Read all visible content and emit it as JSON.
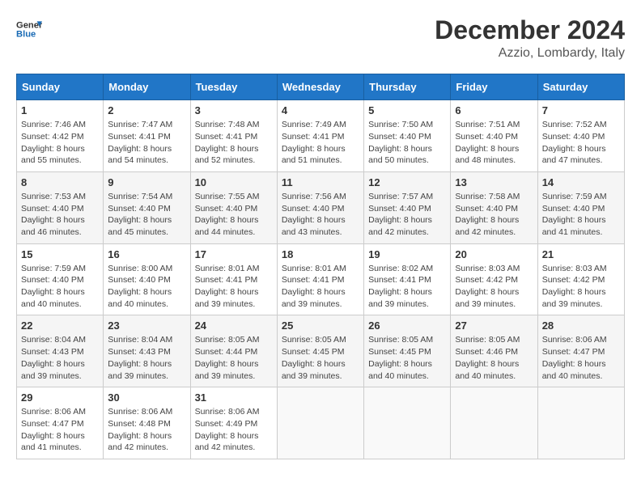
{
  "header": {
    "logo_line1": "General",
    "logo_line2": "Blue",
    "title": "December 2024",
    "subtitle": "Azzio, Lombardy, Italy"
  },
  "calendar": {
    "days_of_week": [
      "Sunday",
      "Monday",
      "Tuesday",
      "Wednesday",
      "Thursday",
      "Friday",
      "Saturday"
    ],
    "weeks": [
      [
        null,
        {
          "day": 2,
          "sunrise": "7:47 AM",
          "sunset": "4:41 PM",
          "daylight": "8 hours and 54 minutes."
        },
        {
          "day": 3,
          "sunrise": "7:48 AM",
          "sunset": "4:41 PM",
          "daylight": "8 hours and 52 minutes."
        },
        {
          "day": 4,
          "sunrise": "7:49 AM",
          "sunset": "4:41 PM",
          "daylight": "8 hours and 51 minutes."
        },
        {
          "day": 5,
          "sunrise": "7:50 AM",
          "sunset": "4:40 PM",
          "daylight": "8 hours and 50 minutes."
        },
        {
          "day": 6,
          "sunrise": "7:51 AM",
          "sunset": "4:40 PM",
          "daylight": "8 hours and 48 minutes."
        },
        {
          "day": 7,
          "sunrise": "7:52 AM",
          "sunset": "4:40 PM",
          "daylight": "8 hours and 47 minutes."
        }
      ],
      [
        {
          "day": 1,
          "sunrise": "7:46 AM",
          "sunset": "4:42 PM",
          "daylight": "8 hours and 55 minutes."
        },
        {
          "day": 8,
          "sunrise": "7:53 AM",
          "sunset": "4:40 PM",
          "daylight": "8 hours and 46 minutes."
        },
        {
          "day": 9,
          "sunrise": "7:54 AM",
          "sunset": "4:40 PM",
          "daylight": "8 hours and 45 minutes."
        },
        {
          "day": 10,
          "sunrise": "7:55 AM",
          "sunset": "4:40 PM",
          "daylight": "8 hours and 44 minutes."
        },
        {
          "day": 11,
          "sunrise": "7:56 AM",
          "sunset": "4:40 PM",
          "daylight": "8 hours and 43 minutes."
        },
        {
          "day": 12,
          "sunrise": "7:57 AM",
          "sunset": "4:40 PM",
          "daylight": "8 hours and 42 minutes."
        },
        {
          "day": 13,
          "sunrise": "7:58 AM",
          "sunset": "4:40 PM",
          "daylight": "8 hours and 42 minutes."
        },
        {
          "day": 14,
          "sunrise": "7:59 AM",
          "sunset": "4:40 PM",
          "daylight": "8 hours and 41 minutes."
        }
      ],
      [
        {
          "day": 15,
          "sunrise": "7:59 AM",
          "sunset": "4:40 PM",
          "daylight": "8 hours and 40 minutes."
        },
        {
          "day": 16,
          "sunrise": "8:00 AM",
          "sunset": "4:40 PM",
          "daylight": "8 hours and 40 minutes."
        },
        {
          "day": 17,
          "sunrise": "8:01 AM",
          "sunset": "4:41 PM",
          "daylight": "8 hours and 39 minutes."
        },
        {
          "day": 18,
          "sunrise": "8:01 AM",
          "sunset": "4:41 PM",
          "daylight": "8 hours and 39 minutes."
        },
        {
          "day": 19,
          "sunrise": "8:02 AM",
          "sunset": "4:41 PM",
          "daylight": "8 hours and 39 minutes."
        },
        {
          "day": 20,
          "sunrise": "8:03 AM",
          "sunset": "4:42 PM",
          "daylight": "8 hours and 39 minutes."
        },
        {
          "day": 21,
          "sunrise": "8:03 AM",
          "sunset": "4:42 PM",
          "daylight": "8 hours and 39 minutes."
        }
      ],
      [
        {
          "day": 22,
          "sunrise": "8:04 AM",
          "sunset": "4:43 PM",
          "daylight": "8 hours and 39 minutes."
        },
        {
          "day": 23,
          "sunrise": "8:04 AM",
          "sunset": "4:43 PM",
          "daylight": "8 hours and 39 minutes."
        },
        {
          "day": 24,
          "sunrise": "8:05 AM",
          "sunset": "4:44 PM",
          "daylight": "8 hours and 39 minutes."
        },
        {
          "day": 25,
          "sunrise": "8:05 AM",
          "sunset": "4:45 PM",
          "daylight": "8 hours and 39 minutes."
        },
        {
          "day": 26,
          "sunrise": "8:05 AM",
          "sunset": "4:45 PM",
          "daylight": "8 hours and 40 minutes."
        },
        {
          "day": 27,
          "sunrise": "8:05 AM",
          "sunset": "4:46 PM",
          "daylight": "8 hours and 40 minutes."
        },
        {
          "day": 28,
          "sunrise": "8:06 AM",
          "sunset": "4:47 PM",
          "daylight": "8 hours and 40 minutes."
        }
      ],
      [
        {
          "day": 29,
          "sunrise": "8:06 AM",
          "sunset": "4:47 PM",
          "daylight": "8 hours and 41 minutes."
        },
        {
          "day": 30,
          "sunrise": "8:06 AM",
          "sunset": "4:48 PM",
          "daylight": "8 hours and 42 minutes."
        },
        {
          "day": 31,
          "sunrise": "8:06 AM",
          "sunset": "4:49 PM",
          "daylight": "8 hours and 42 minutes."
        },
        null,
        null,
        null,
        null
      ]
    ]
  }
}
